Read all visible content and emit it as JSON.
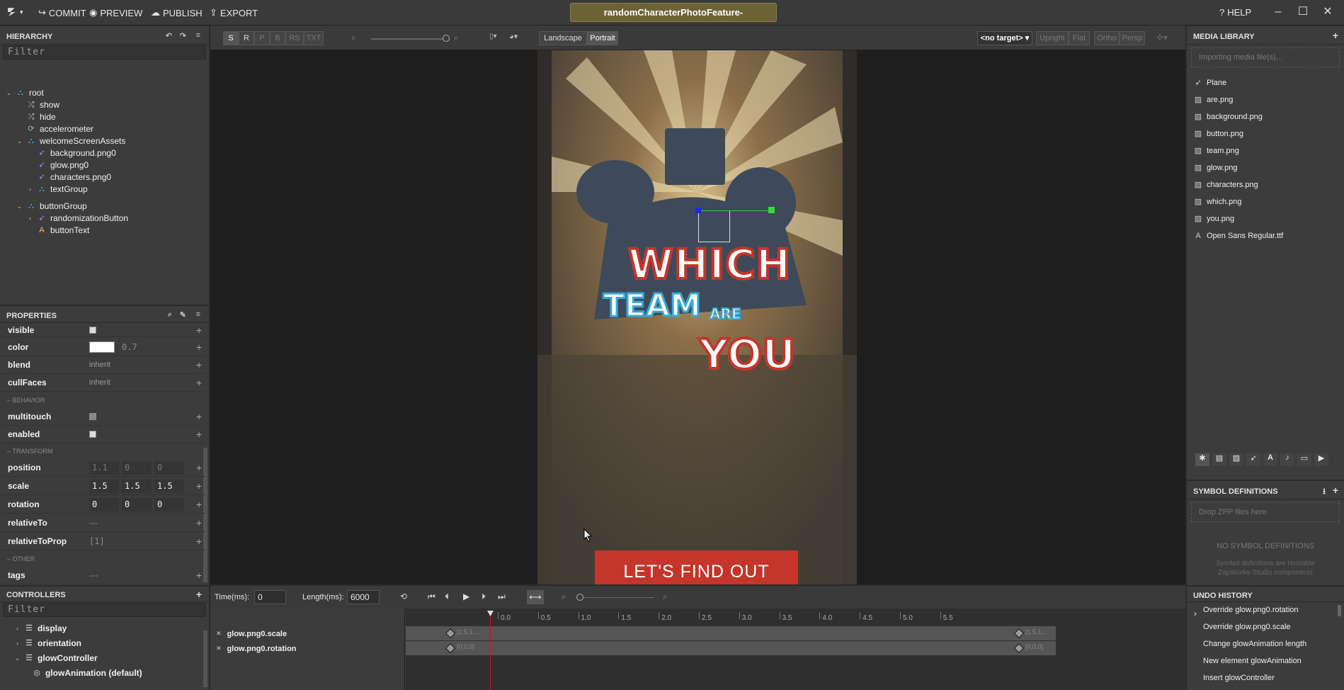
{
  "topbar": {
    "commit": "COMMIT",
    "preview": "PREVIEW",
    "publish": "PUBLISH",
    "export": "EXPORT",
    "title": "randomCharacterPhotoFeature-",
    "help": "HELP"
  },
  "hierarchy": {
    "title": "HIERARCHY",
    "filter_placeholder": "Filter",
    "items": [
      {
        "label": "root",
        "icon": "group-icon"
      },
      {
        "label": "show",
        "icon": "shuffle-icon"
      },
      {
        "label": "hide",
        "icon": "shuffle-icon"
      },
      {
        "label": "accelerometer",
        "icon": "sync-icon"
      },
      {
        "label": "welcomeScreenAssets",
        "icon": "group-icon"
      },
      {
        "label": "background.png0",
        "icon": "rocket-icon"
      },
      {
        "label": "glow.png0",
        "icon": "rocket-icon"
      },
      {
        "label": "characters.png0",
        "icon": "rocket-icon"
      },
      {
        "label": "textGroup",
        "icon": "group-icon"
      },
      {
        "label": "buttonGroup",
        "icon": "group-icon"
      },
      {
        "label": "randomizationButton",
        "icon": "rocket-icon"
      },
      {
        "label": "buttonText",
        "icon": "text-icon"
      }
    ]
  },
  "properties": {
    "title": "PROPERTIES",
    "visible": "visible",
    "color": "color",
    "color_alpha": "0.7",
    "blend": "blend",
    "blend_val": "inherit",
    "cullFaces": "cullFaces",
    "cullFaces_val": "inherit",
    "behavior": "BEHAVIOR",
    "multitouch": "multitouch",
    "enabled": "enabled",
    "transform": "TRANSFORM",
    "position": "position",
    "position_vals": [
      "1.1",
      "0",
      "0"
    ],
    "scale": "scale",
    "scale_vals": [
      "1.5",
      "1.5",
      "1.5"
    ],
    "rotation": "rotation",
    "rotation_vals": [
      "0",
      "0",
      "0"
    ],
    "relativeTo": "relativeTo",
    "relativeTo_val": "---",
    "relativeToProp": "relativeToProp",
    "relativeToProp_val": "[1]",
    "other": "OTHER",
    "tags": "tags",
    "tags_val": "---"
  },
  "controllers": {
    "title": "CONTROLLERS",
    "filter_placeholder": "Filter",
    "items": [
      "display",
      "orientation",
      "glowController",
      "glowAnimation (default)"
    ]
  },
  "viewport_toolbar": {
    "s": "S",
    "r": "R",
    "p": "P",
    "b": "B",
    "rs": "RS",
    "txt": "TXT",
    "landscape": "Landscape",
    "portrait": "Portrait",
    "target": "<no target>",
    "upright": "Upright",
    "flat": "Flat",
    "ortho": "Ortho",
    "persp": "Persp"
  },
  "canvas": {
    "which": "WHICH",
    "team": "TEAM",
    "are": "ARE",
    "you": "YOU",
    "cta": "LET'S FIND OUT"
  },
  "media": {
    "title": "MEDIA LIBRARY",
    "import_placeholder": "Importing media file(s)...",
    "items": [
      "Plane",
      "are.png",
      "background.png",
      "button.png",
      "team.png",
      "glow.png",
      "characters.png",
      "which.png",
      "you.png",
      "Open Sans Regular.ttf"
    ]
  },
  "symbols": {
    "title": "SYMBOL DEFINITIONS",
    "drop": "Drop ZPP files here",
    "empty": "NO SYMBOL DEFINITIONS",
    "hint1": "Symbol definitions are reusable",
    "hint2": "ZapWorks Studio components"
  },
  "undo": {
    "title": "UNDO HISTORY",
    "items": [
      "Override glow.png0.rotation",
      "Override glow.png0.scale",
      "Change glowAnimation length",
      "New element glowAnimation",
      "Insert glowController"
    ]
  },
  "timeline": {
    "time_label": "Time(ms):",
    "time_val": "0",
    "length_label": "Length(ms):",
    "length_val": "6000",
    "ticks": [
      "0.0",
      "0.5",
      "1.0",
      "1.5",
      "2.0",
      "2.5",
      "3.0",
      "3.5",
      "4.0",
      "4.5",
      "5.0",
      "5.5"
    ],
    "tracks": [
      {
        "label": "glow.png0.scale",
        "start": "[1.5,1...",
        "end": "[1.5,1..."
      },
      {
        "label": "glow.png0.rotation",
        "start": "[0,0,0]",
        "end": "[0,0,0]"
      }
    ]
  },
  "colors": {
    "accent_red": "#c4352a",
    "title_bg": "#6b6335",
    "team_blue": "#3aa9d6"
  }
}
